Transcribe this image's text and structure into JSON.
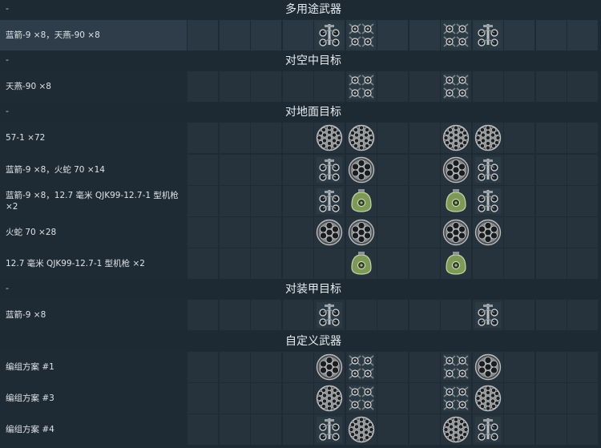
{
  "sections": [
    {
      "dash": "-",
      "title": "多用途武器",
      "rows": [
        {
          "label": "蓝箭-9 ×8，天燕-90 ×8",
          "selected": true,
          "slots": {
            "4": "ar2-icon",
            "5": "aa-quad-icon",
            "8": "aa-quad-icon",
            "9": "ar2-icon"
          }
        }
      ]
    },
    {
      "dash": "-",
      "title": "对空中目标",
      "rows": [
        {
          "label": "天燕-90 ×8",
          "slots": {
            "5": "aa-quad-icon",
            "8": "aa-quad-icon"
          }
        }
      ]
    },
    {
      "dash": "-",
      "title": "对地面目标",
      "rows": [
        {
          "label": "57-1 ×72",
          "slots": {
            "4": "rocket-pod-large-icon",
            "5": "rocket-pod-large-icon",
            "8": "rocket-pod-large-icon",
            "9": "rocket-pod-large-icon"
          }
        },
        {
          "label": "蓝箭-9 ×8，火蛇 70 ×14",
          "slots": {
            "4": "ar2-icon",
            "5": "rocket-pod-small-icon",
            "8": "rocket-pod-small-icon",
            "9": "ar2-icon"
          }
        },
        {
          "label": "蓝箭-9 ×8，12.7 毫米 QJK99-12.7-1 型机枪 ×2",
          "slots": {
            "4": "ar2-icon",
            "5": "gun-pod-icon",
            "8": "gun-pod-icon",
            "9": "ar2-icon"
          }
        },
        {
          "label": "火蛇 70 ×28",
          "slots": {
            "4": "rocket-pod-small-icon",
            "5": "rocket-pod-small-icon",
            "8": "rocket-pod-small-icon",
            "9": "rocket-pod-small-icon"
          }
        },
        {
          "label": "12.7 毫米 QJK99-12.7-1 型机枪 ×2",
          "slots": {
            "5": "gun-pod-icon",
            "8": "gun-pod-icon"
          }
        }
      ]
    },
    {
      "dash": "-",
      "title": "对装甲目标",
      "rows": [
        {
          "label": "蓝箭-9 ×8",
          "slots": {
            "4": "ar2-icon",
            "9": "ar2-icon"
          }
        }
      ]
    },
    {
      "dash": "",
      "title": "自定义武器",
      "rows": [
        {
          "label": "编组方案 #1",
          "slots": {
            "4": "rocket-pod-small-icon",
            "5": "aa-quad-icon",
            "8": "aa-quad-icon",
            "9": "rocket-pod-small-icon"
          }
        },
        {
          "label": "编组方案 #3",
          "slots": {
            "4": "rocket-pod-large-icon",
            "5": "aa-quad-icon",
            "8": "aa-quad-icon",
            "9": "rocket-pod-large-icon"
          }
        },
        {
          "label": "编组方案 #4",
          "slots": {
            "4": "ar2-icon",
            "5": "rocket-pod-large-icon",
            "8": "rocket-pod-large-icon",
            "9": "ar2-icon"
          }
        }
      ]
    }
  ],
  "colors": {
    "background": "#1e2a34",
    "cell": "#26323c",
    "selected_row": "#2e3d49",
    "header_text": "#e6ecf0"
  }
}
